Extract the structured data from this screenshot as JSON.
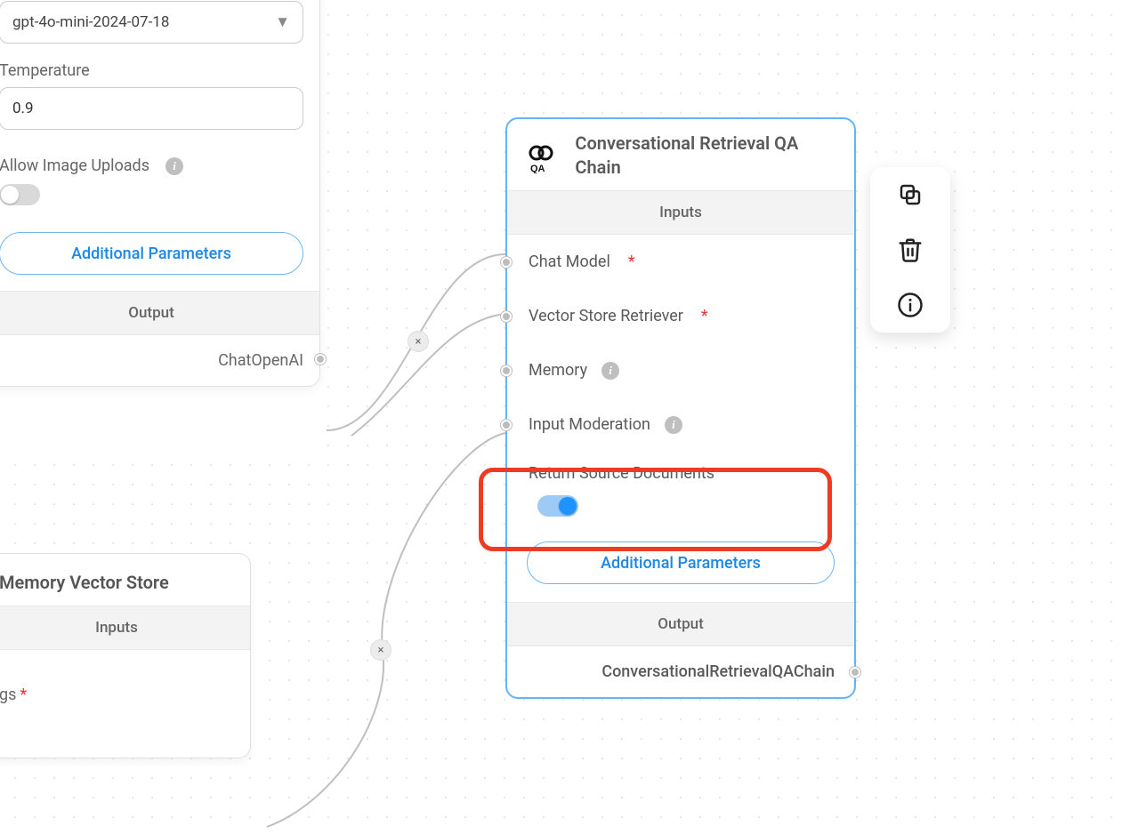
{
  "left_node": {
    "model_name": "gpt-4o-mini-2024-07-18",
    "temperature_label": "Temperature",
    "temperature_value": "0.9",
    "allow_image_label": "Allow Image Uploads",
    "allow_image_on": false,
    "additional_label": "Additional Parameters",
    "output_band": "Output",
    "output_label": "ChatOpenAI"
  },
  "mem_node": {
    "title": "Memory Vector Store",
    "inputs_band": "Inputs",
    "gs_label": "gs"
  },
  "qa_node": {
    "title": "Conversational Retrieval QA Chain",
    "inputs_band": "Inputs",
    "inputs": {
      "chat_model": "Chat Model",
      "vector_store": "Vector Store Retriever",
      "memory": "Memory",
      "moderation": "Input Moderation",
      "return_src": "Return Source Documents"
    },
    "return_src_on": true,
    "additional_label": "Additional Parameters",
    "output_band": "Output",
    "output_label": "ConversationalRetrievalQAChain"
  },
  "toolbar": {
    "copy": "copy",
    "delete": "delete",
    "info": "info"
  },
  "colors": {
    "accent": "#1e88e5",
    "node_border": "#64b5f6",
    "highlight": "#ef3b24"
  }
}
